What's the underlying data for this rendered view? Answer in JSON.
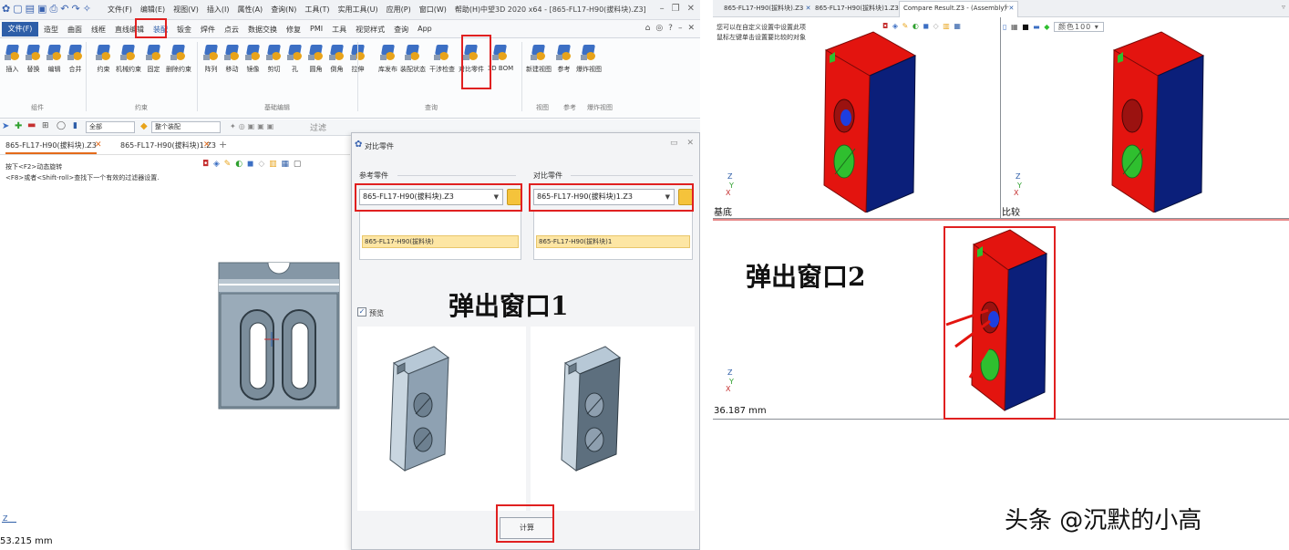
{
  "left_app": {
    "title": "中望3D 2020 x64 - [865-FL17-H90(拔料块).Z3]",
    "menus": [
      "文件(F)",
      "编辑(E)",
      "视图(V)",
      "插入(I)",
      "属性(A)",
      "查询(N)",
      "工具(T)",
      "实用工具(U)",
      "应用(P)",
      "窗口(W)",
      "帮助(H)"
    ],
    "file_tab": "文件(F)",
    "ribbon_tabs": [
      "造型",
      "曲面",
      "线框",
      "直线编辑",
      "装配",
      "钣金",
      "焊件",
      "点云",
      "数据交换",
      "修复",
      "PMI",
      "工具",
      "视觉样式",
      "查询",
      "App"
    ],
    "active_tab": "装配",
    "ribbon_items": [
      {
        "label": "插入"
      },
      {
        "label": "替换"
      },
      {
        "label": "编辑"
      },
      {
        "label": "合并"
      },
      {
        "label": "约束"
      },
      {
        "label": "机械约束"
      },
      {
        "label": "固定"
      },
      {
        "label": "删除约束"
      },
      {
        "label": "阵列"
      },
      {
        "label": "移动"
      },
      {
        "label": "镜像"
      },
      {
        "label": "剪切"
      },
      {
        "label": "孔"
      },
      {
        "label": "圆角"
      },
      {
        "label": "倒角"
      },
      {
        "label": "拉伸"
      },
      {
        "label": "库发布"
      },
      {
        "label": "装配状态"
      },
      {
        "label": "干涉检查"
      },
      {
        "label": "对比零件"
      },
      {
        "label": "3D BOM"
      },
      {
        "label": "新建视图"
      },
      {
        "label": "参考"
      },
      {
        "label": "爆炸视图"
      }
    ],
    "ribbon_groups": [
      "组件",
      "约束",
      "基础编辑",
      "查询",
      "视图",
      "参考",
      "爆炸视图"
    ],
    "filter_all": "全部",
    "filter_assembly": "整个装配",
    "filter_hint": "过滤",
    "doc_tabs": [
      "865-FL17-H90(拔料块).Z3",
      "865-FL17-H90(拔料块)1.Z3"
    ],
    "hint_line1": "按下<F2>动态旋转",
    "hint_line2": "<F8>或者<Shift-roll>查找下一个有效的过滤器设置.",
    "axis_label": "Z",
    "dimension": "53.215 mm"
  },
  "dialog": {
    "title": "对比零件",
    "reference_label": "参考零件",
    "compare_label": "对比零件",
    "reference_combo": "865-FL17-H90(拔料块).Z3",
    "compare_combo": "865-FL17-H90(拔料块)1.Z3",
    "reference_item": "865-FL17-H90(拔料块)",
    "compare_item": "865-FL17-H90(拔料块)1",
    "preview_label": "预览",
    "preview_checked": true,
    "calc_button": "计算"
  },
  "annotations": {
    "popup1": "弹出窗口1",
    "popup2": "弹出窗口2",
    "watermark": "头条 @沉默的小高"
  },
  "right_app": {
    "tabs": [
      "865-FL17-H90(拔料块).Z3",
      "865-FL17-H90(拔料块)1.Z3",
      "Compare Result.Z3 - (Assembly)"
    ],
    "hint_line1": "您可以在自定义设置中设置此项",
    "hint_line2": "鼠标左键单击设置要比较的对象",
    "scale_text": "颜色100",
    "pane_base": "基底",
    "pane_compare": "比较",
    "axis_label": "Z",
    "dimension": "36.187 mm"
  },
  "colors": {
    "brand_blue": "#2e5ea8",
    "highlight_red": "#e02020",
    "part_red": "#e3140f",
    "part_navy": "#0b1f7a",
    "part_green": "#2fbf2f",
    "part_gray": "#7a8d9e"
  }
}
